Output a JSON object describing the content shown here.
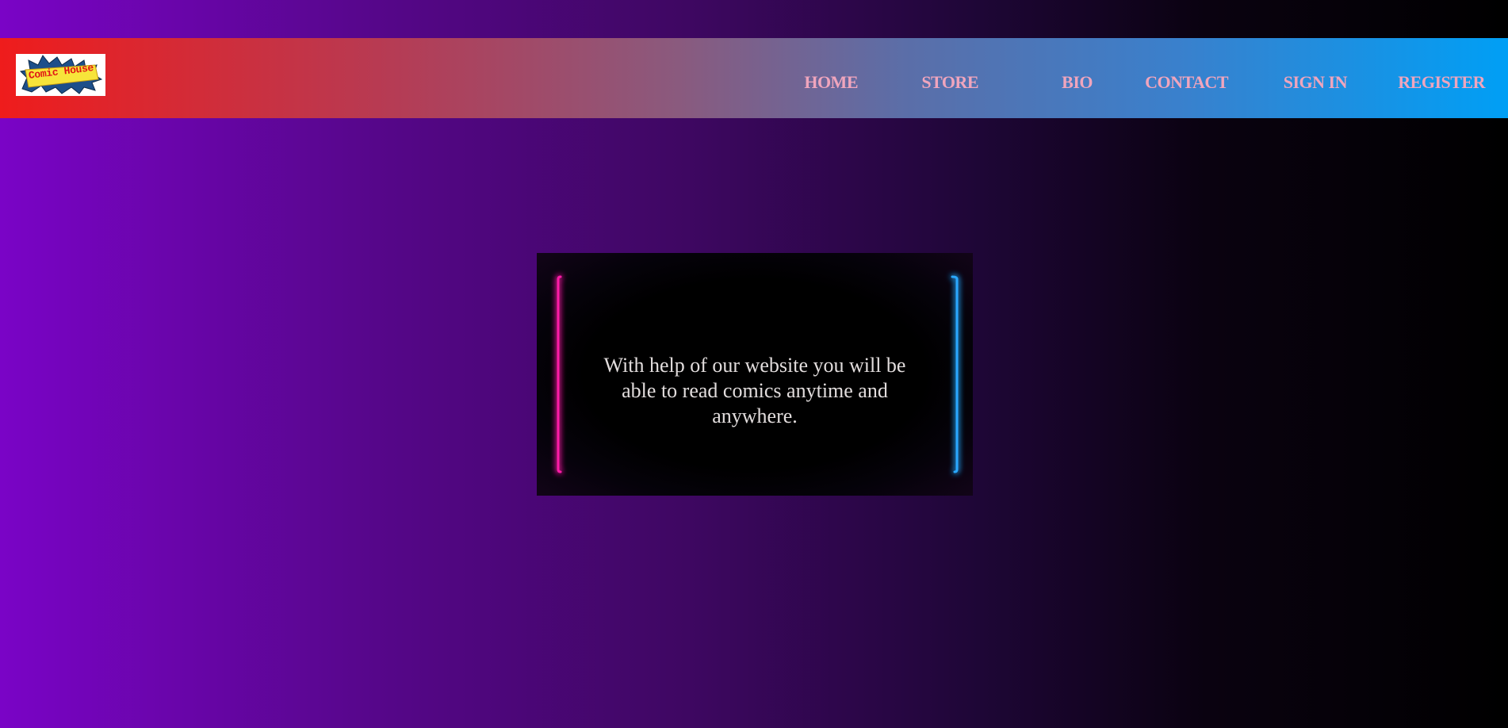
{
  "header": {
    "logo_text": "Comic House",
    "nav": [
      {
        "label": "HOME"
      },
      {
        "label": "STORE"
      },
      {
        "label": "BIO"
      },
      {
        "label": "CONTACT"
      },
      {
        "label": "SIGN IN"
      },
      {
        "label": "REGISTER"
      }
    ]
  },
  "hero": {
    "text": "With help of our website you will be able to read comics anytime and anywhere."
  },
  "colors": {
    "nav_text": "#f0a5bd",
    "neon_pink": "#ff1ea8",
    "neon_blue": "#2aa8ff",
    "navbar_start": "#ef1c1c",
    "navbar_end": "#009ff5",
    "bg_start": "#7a04c6",
    "bg_end": "#000000"
  }
}
